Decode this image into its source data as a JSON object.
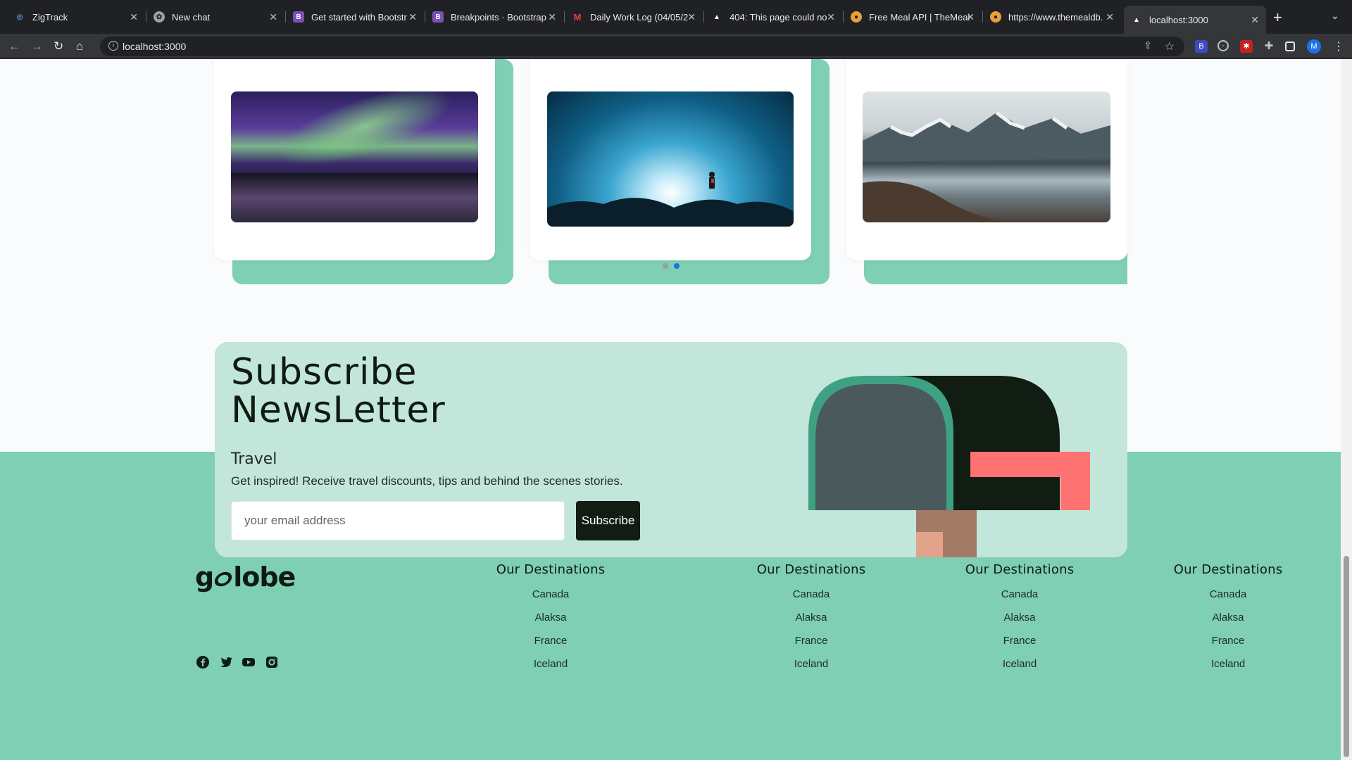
{
  "browser": {
    "tabs": [
      {
        "title": "ZigTrack",
        "favicon": "zigtrack-icon",
        "color": "#5f8ecf"
      },
      {
        "title": "New chat",
        "favicon": "chatgpt-icon",
        "color": "#9aa0a6"
      },
      {
        "title": "Get started with Bootstr",
        "favicon": "bootstrap-icon",
        "color": "#7952b3"
      },
      {
        "title": "Breakpoints · Bootstrap",
        "favicon": "bootstrap-icon",
        "color": "#7952b3"
      },
      {
        "title": "Daily Work Log (04/05/2",
        "favicon": "gmail-icon",
        "color": "#ea4335"
      },
      {
        "title": "404: This page could no",
        "favicon": "vercel-icon",
        "color": "#ffffff"
      },
      {
        "title": "Free Meal API | TheMeal",
        "favicon": "mealdb-icon",
        "color": "#e8a13a"
      },
      {
        "title": "https://www.themealdb.",
        "favicon": "mealdb-icon",
        "color": "#e8a13a"
      },
      {
        "title": "localhost:3000",
        "favicon": "vercel-icon",
        "color": "#ffffff",
        "active": true
      }
    ],
    "url": "localhost:3000",
    "profile_initial": "M"
  },
  "carousel": {
    "active_index": 1,
    "dot_count": 2
  },
  "subscribe": {
    "title_line1": "Subscribe",
    "title_line2": "NewsLetter",
    "subtitle": "Travel",
    "description": "Get inspired! Receive travel discounts, tips and behind the scenes stories.",
    "email_placeholder": "your email address",
    "button_label": "Subscribe"
  },
  "footer": {
    "logo_text": "globe",
    "logo_prefix": "g",
    "social": [
      "facebook-icon",
      "twitter-icon",
      "youtube-icon",
      "instagram-icon"
    ],
    "columns": [
      {
        "heading": "Our Destinations",
        "links": [
          "Canada",
          "Alaksa",
          "France",
          "Iceland"
        ]
      },
      {
        "heading": "Our Destinations",
        "links": [
          "Canada",
          "Alaksa",
          "France",
          "Iceland"
        ]
      },
      {
        "heading": "Our Destinations",
        "links": [
          "Canada",
          "Alaksa",
          "France",
          "Iceland"
        ]
      },
      {
        "heading": "Our Destinations",
        "links": [
          "Canada",
          "Alaksa",
          "France",
          "Iceland"
        ]
      }
    ]
  },
  "colors": {
    "brand_green": "#7ecfb3",
    "light_green": "#c3e6da",
    "dark": "#111c12",
    "coral": "#ff7272"
  }
}
